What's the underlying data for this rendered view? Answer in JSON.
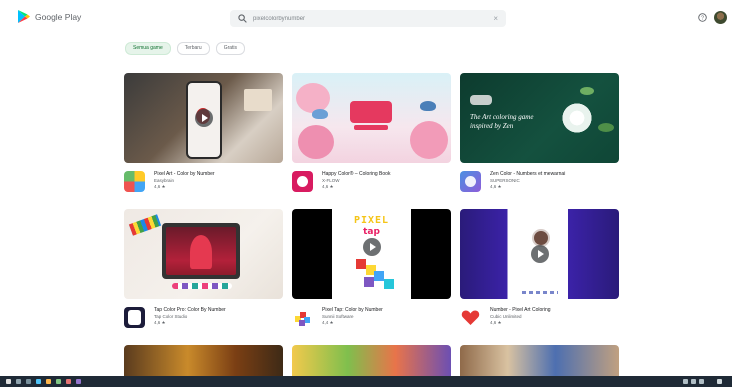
{
  "header": {
    "logo_text": "Google Play",
    "search_value": "pixelcolorbynumber"
  },
  "chips": [
    "Semua game",
    "Terbaru",
    "Gratis"
  ],
  "apps": [
    {
      "title": "Pixel Art - Color by Number",
      "developer": "Easybrain",
      "rating": "4,6"
    },
    {
      "title": "Happy Color® – Coloring Book",
      "developer": "X-FLOW",
      "rating": "4,6"
    },
    {
      "title": "Zen Color - Numbers et mewarnai",
      "developer": "SUPERSONIC",
      "rating": "4,6"
    },
    {
      "title": "Tap Color Pro: Color By Number",
      "developer": "Tap Color Studio",
      "rating": "4,6"
    },
    {
      "title": "Pixel Tap: Color by Number",
      "developer": "Sunnii Software",
      "rating": "4,4"
    },
    {
      "title": "Number - Pixel Art Coloring",
      "developer": "Cubic Unlimited",
      "rating": "4,6"
    }
  ],
  "banner_texts": {
    "zen_headline": "The Art coloring game inspired by Zen",
    "pixel_tap_line1": "PIXEL",
    "pixel_tap_line2": "tap"
  },
  "icons": {
    "search": "search-icon",
    "clear": "close-icon",
    "help": "help-icon",
    "star": "star-icon"
  },
  "colors": {
    "play_green": "#01875f",
    "chip_active_bg": "#e6f4ea",
    "taskbar": "#1f2a36"
  }
}
